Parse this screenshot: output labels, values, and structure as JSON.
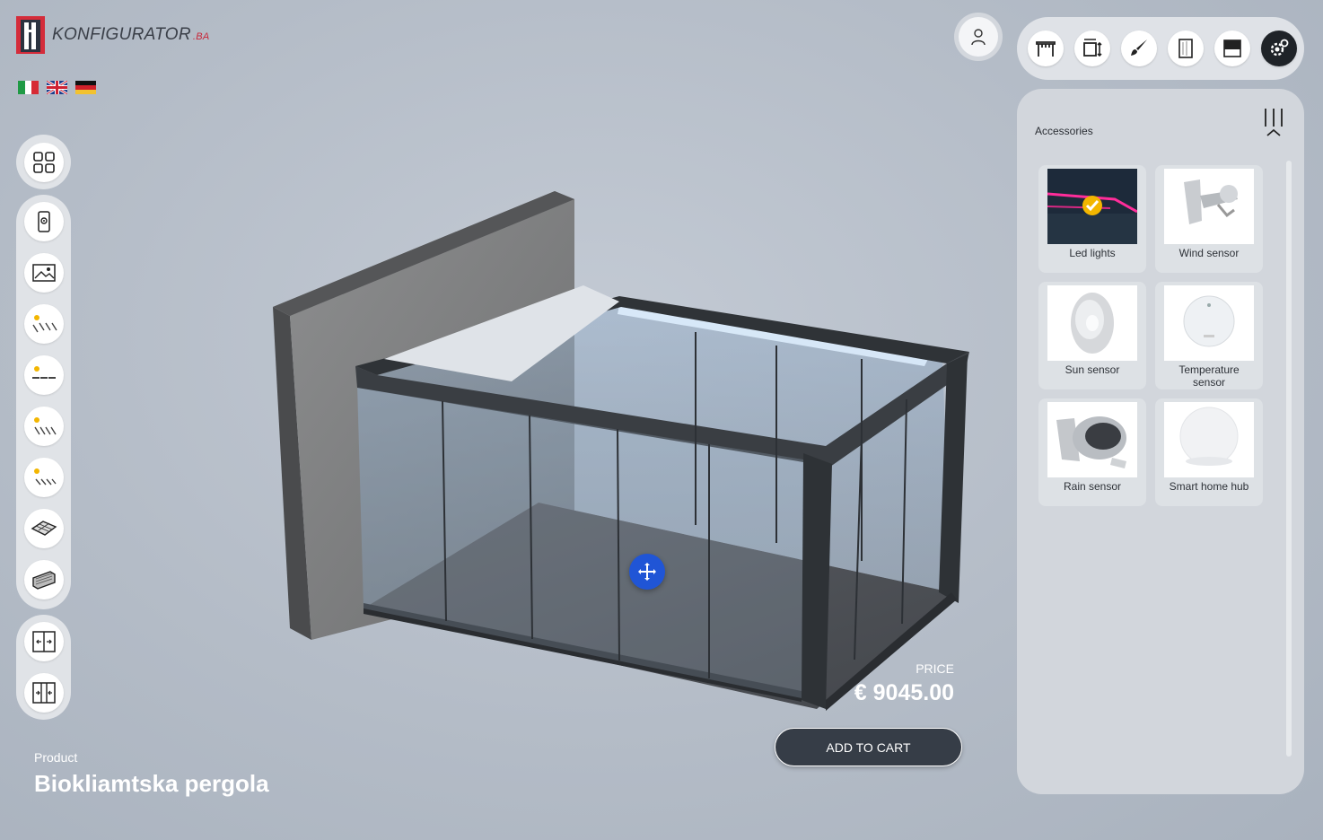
{
  "brand": {
    "name": "KONFIGURATOR",
    "tld": ".BA"
  },
  "languages": [
    {
      "code": "it",
      "icon": "italian-flag-icon"
    },
    {
      "code": "en",
      "icon": "uk-flag-icon"
    },
    {
      "code": "de",
      "icon": "german-flag-icon"
    }
  ],
  "toolbar": {
    "tools": [
      {
        "icon": "pergola-frame-icon",
        "active": false
      },
      {
        "icon": "dimensions-icon",
        "active": false
      },
      {
        "icon": "paint-brush-icon",
        "active": false
      },
      {
        "icon": "glass-panel-icon",
        "active": false
      },
      {
        "icon": "shade-screen-icon",
        "active": false
      },
      {
        "icon": "settings-gear-icon",
        "active": true
      }
    ]
  },
  "panel": {
    "title": "Accessories",
    "items": [
      {
        "label": "Led lights",
        "selected": true,
        "icon": "led-lights-thumbnail"
      },
      {
        "label": "Wind sensor",
        "selected": false,
        "icon": "wind-sensor-thumbnail"
      },
      {
        "label": "Sun sensor",
        "selected": false,
        "icon": "sun-sensor-thumbnail"
      },
      {
        "label": "Temperature sensor",
        "selected": false,
        "icon": "temperature-sensor-thumbnail"
      },
      {
        "label": "Rain sensor",
        "selected": false,
        "icon": "rain-sensor-thumbnail"
      },
      {
        "label": "Smart home hub",
        "selected": false,
        "icon": "smart-home-hub-thumbnail"
      }
    ]
  },
  "left_rail": {
    "top_icon": "grid-menu-icon",
    "items": [
      "ar-view-icon",
      "background-image-icon",
      "louvers-open-icon",
      "louvers-flat-icon",
      "louvers-half-icon",
      "louvers-closed-icon",
      "floor-panel-icon",
      "wall-panel-icon"
    ],
    "bottom_items": [
      "doors-open-icon",
      "doors-close-icon"
    ]
  },
  "product": {
    "label": "Product",
    "name": "Biokliamtska pergola"
  },
  "price": {
    "label": "PRICE",
    "value": "€ 9045.00"
  },
  "cart": {
    "label": "ADD TO CART"
  },
  "colors": {
    "accent": "#2055d6",
    "dark": "#363d47",
    "brand_red": "#c8283a"
  }
}
